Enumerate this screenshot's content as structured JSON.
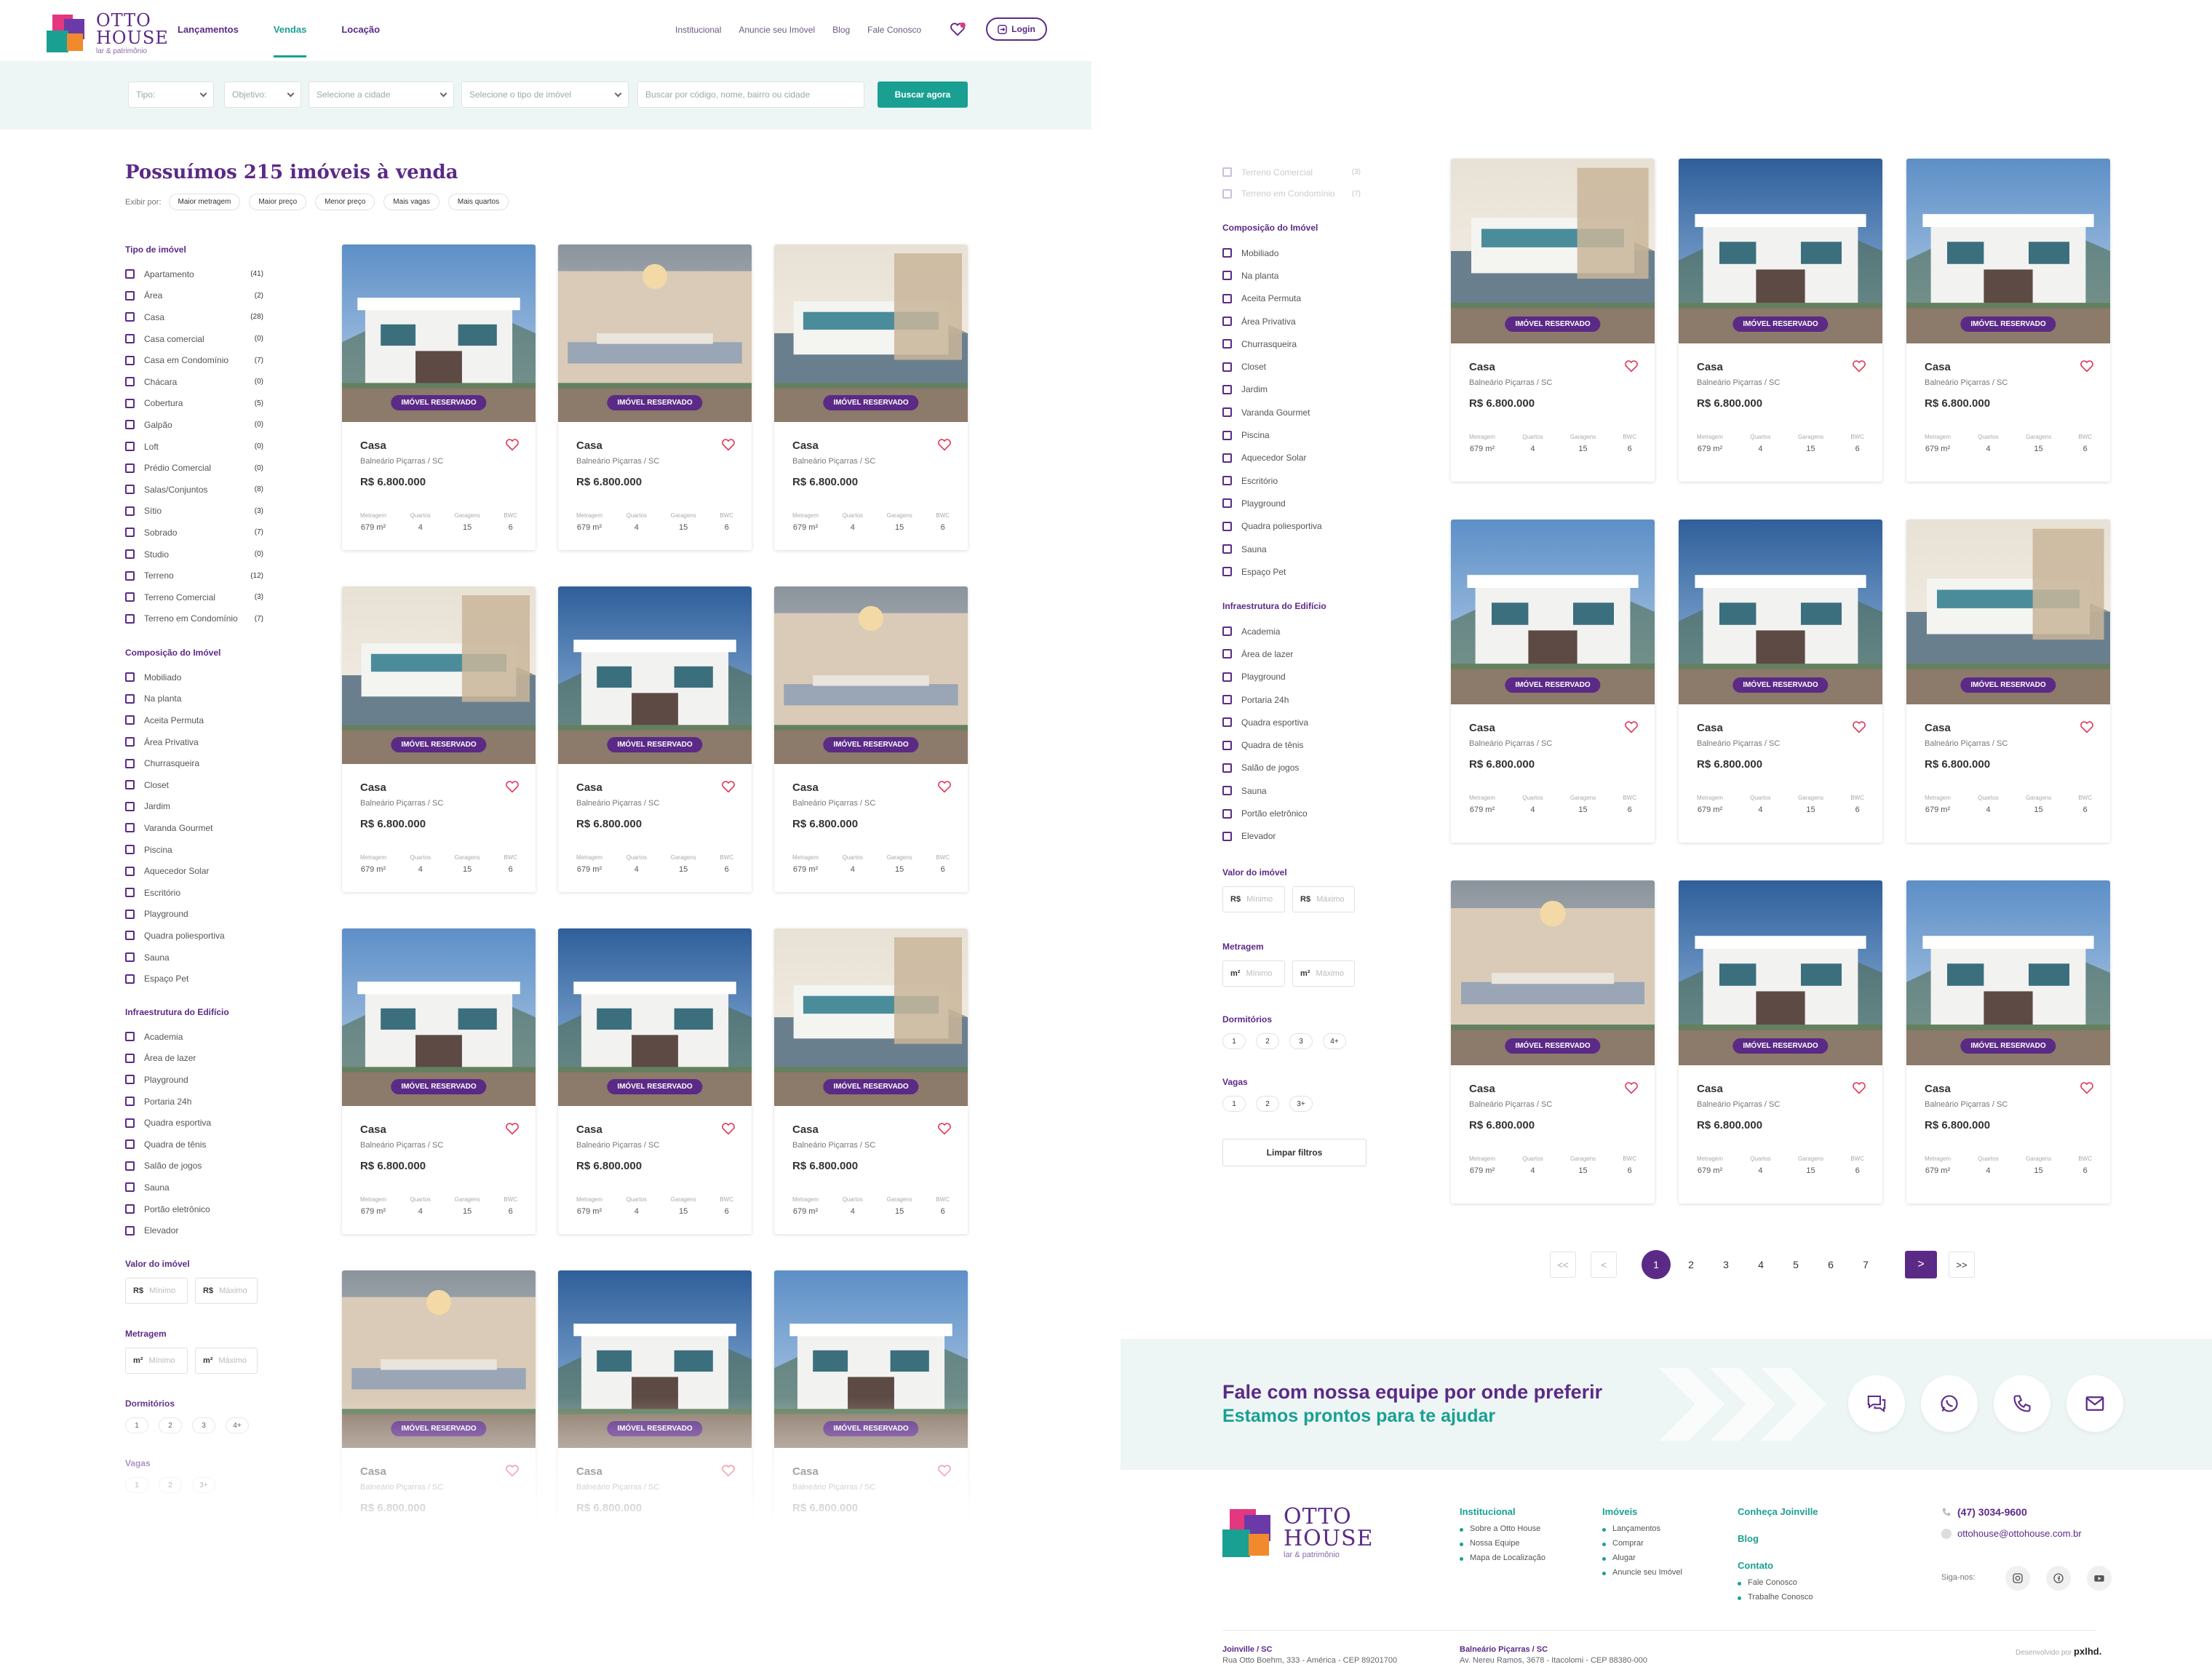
{
  "logo": {
    "line1": "OTTO",
    "line2": "HOUSE",
    "tagline": "lar & patrimônio"
  },
  "nav": {
    "items": [
      "Lançamentos",
      "Vendas",
      "Locação"
    ],
    "active": "Vendas",
    "links": [
      "Institucional",
      "Anuncie seu Imóvel",
      "Blog",
      "Fale Conosco"
    ],
    "login": "Login"
  },
  "search": {
    "tipo": "Tipo:",
    "objetivo": "Objetivo:",
    "cidade": "Selecione a cidade",
    "tipo_imovel": "Selecione o tipo de imóvel",
    "query_placeholder": "Buscar por código, nome, bairro ou cidade",
    "button": "Buscar agora"
  },
  "results": {
    "title": "Possuímos 215 imóveis à venda",
    "sort_label": "Exibir por:",
    "sort_options": [
      "Maior metragem",
      "Maior preço",
      "Menor preço",
      "Mais vagas",
      "Mais quartos"
    ]
  },
  "filters": {
    "tipo_title": "Tipo de imóvel",
    "tipo_items": [
      {
        "label": "Apartamento",
        "count": "(41)"
      },
      {
        "label": "Área",
        "count": "(2)"
      },
      {
        "label": "Casa",
        "count": "(28)"
      },
      {
        "label": "Casa comercial",
        "count": "(0)"
      },
      {
        "label": "Casa em Condomínio",
        "count": "(7)"
      },
      {
        "label": "Chácara",
        "count": "(0)"
      },
      {
        "label": "Cobertura",
        "count": "(5)"
      },
      {
        "label": "Galpão",
        "count": "(0)"
      },
      {
        "label": "Loft",
        "count": "(0)"
      },
      {
        "label": "Prédio Comercial",
        "count": "(0)"
      },
      {
        "label": "Salas/Conjuntos",
        "count": "(8)"
      },
      {
        "label": "Sítio",
        "count": "(3)"
      },
      {
        "label": "Sobrado",
        "count": "(7)"
      },
      {
        "label": "Studio",
        "count": "(0)"
      },
      {
        "label": "Terreno",
        "count": "(12)"
      },
      {
        "label": "Terreno Comercial",
        "count": "(3)"
      },
      {
        "label": "Terreno em Condomínio",
        "count": "(7)"
      }
    ],
    "composicao_title": "Composição do Imóvel",
    "composicao_items": [
      "Mobiliado",
      "Na planta",
      "Aceita Permuta",
      "Área Privativa",
      "Churrasqueira",
      "Closet",
      "Jardim",
      "Varanda Gourmet",
      "Piscina",
      "Aquecedor Solar",
      "Escritório",
      "Playground",
      "Quadra poliesportiva",
      "Sauna",
      "Espaço Pet"
    ],
    "infra_title": "Infraestrutura do Edifício",
    "infra_items": [
      "Academia",
      "Área de lazer",
      "Playground",
      "Portaria 24h",
      "Quadra esportiva",
      "Quadra de tênis",
      "Salão de jogos",
      "Sauna",
      "Portão eletrônico",
      "Elevador"
    ],
    "valor_title": "Valor do imóvel",
    "valor_prefix": "R$",
    "min": "Mínimo",
    "max": "Máximo",
    "metragem_title": "Metragem",
    "metragem_prefix": "m²",
    "dorm_title": "Dormitórios",
    "dorm_options": [
      "1",
      "2",
      "3",
      "4+"
    ],
    "vagas_title": "Vagas",
    "vagas_options": [
      "1",
      "2",
      "3+"
    ],
    "clear": "Limpar filtros"
  },
  "card": {
    "type": "Casa",
    "location": "Balneário Piçarras / SC",
    "price": "R$ 6.800.000",
    "badge": "IMÓVEL RESERVADO",
    "spec_labels": [
      "Metragem",
      "Quartos",
      "Garagens",
      "BWC"
    ],
    "spec_values": [
      "679 m²",
      "4",
      "15",
      "6"
    ]
  },
  "pagination": {
    "first": "<<",
    "prev": "<",
    "pages": [
      "1",
      "2",
      "3",
      "4",
      "5",
      "6",
      "7"
    ],
    "current": "1",
    "next": ">",
    "last": ">>"
  },
  "contact": {
    "title": "Fale com nossa equipe por onde preferir",
    "subtitle": "Estamos prontos para te ajudar"
  },
  "footer": {
    "institucional": {
      "title": "Institucional",
      "items": [
        "Sobre a Otto House",
        "Nossa Equipe",
        "Mapa de Localização"
      ]
    },
    "imoveis": {
      "title": "Imóveis",
      "items": [
        "Lançamentos",
        "Comprar",
        "Alugar",
        "Anuncie seu Imóvel"
      ]
    },
    "joinville": "Conheça Joinville",
    "blog": "Blog",
    "contato": {
      "title": "Contato",
      "items": [
        "Fale Conosco",
        "Trabalhe Conosco"
      ]
    },
    "phone": "(47) 3034-9600",
    "email": "ottohouse@ottohouse.com.br",
    "follow": "Siga-nos:",
    "addr1_city": "Joinville / SC",
    "addr1": "Rua Otto Boehm, 333 - América - CEP 89201700",
    "addr2_city": "Balneário Piçarras / SC",
    "addr2": "Av. Nereu Ramos, 3678 - Itacolomi - CEP 88380-000",
    "dev": "Desenvolvido por",
    "dev_brand": "pxlhd."
  },
  "colors": {
    "purple": "#5b2a86",
    "teal": "#19a093",
    "bg_soft": "#eef5f5"
  },
  "icons": [
    "heart-icon",
    "login-icon",
    "chat-icon",
    "whatsapp-icon",
    "phone-icon",
    "mail-icon",
    "instagram-icon",
    "facebook-icon",
    "youtube-icon"
  ]
}
